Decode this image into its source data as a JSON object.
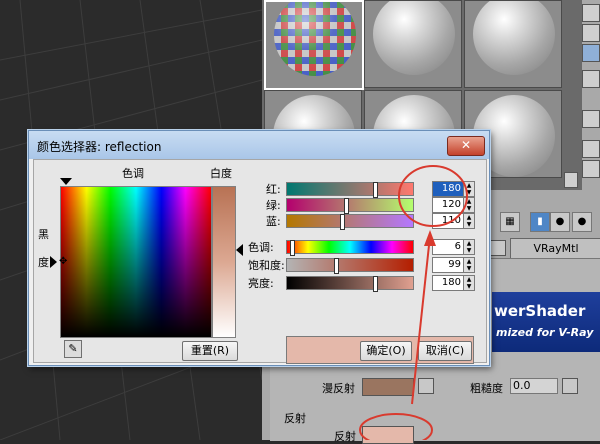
{
  "dialog": {
    "title": "颜色选择器: reflection",
    "close_label": "✕",
    "hue_header": "色调",
    "whiteness_header": "白度",
    "blackness_char_1": "黑",
    "blackness_char_2": "度",
    "reset_label": "重置(R)",
    "ok_label": "确定(O)",
    "cancel_label": "取消(C)",
    "eyedropper_icon": "eyedropper-icon"
  },
  "rgb": [
    {
      "label": "红:",
      "value": "180",
      "fraction": 0.706,
      "selected": true
    },
    {
      "label": "绿:",
      "value": "120",
      "fraction": 0.471,
      "selected": false
    },
    {
      "label": "蓝:",
      "value": "110",
      "fraction": 0.431,
      "selected": false
    }
  ],
  "hsv": [
    {
      "label": "色调:",
      "value": "6",
      "fraction": 0.024
    },
    {
      "label": "饱和度:",
      "value": "99",
      "fraction": 0.388
    },
    {
      "label": "亮度:",
      "value": "180",
      "fraction": 0.706
    }
  ],
  "preview_color": "#e4b8aa",
  "material_editor": {
    "type_label": "VRayMtl",
    "banner_line1": "werShader",
    "banner_line2": "mized for V-Ray",
    "diffuse_label": "漫反射",
    "roughness_label": "粗糙度",
    "roughness_value": "0.0",
    "reflection_section": "反射",
    "reflection_label": "反射",
    "diffuse_color": "#9a7560",
    "reflection_color": "#e4b8aa"
  },
  "colors": {
    "annotation": "#d93a2e",
    "selection": "#1e5fbd"
  }
}
